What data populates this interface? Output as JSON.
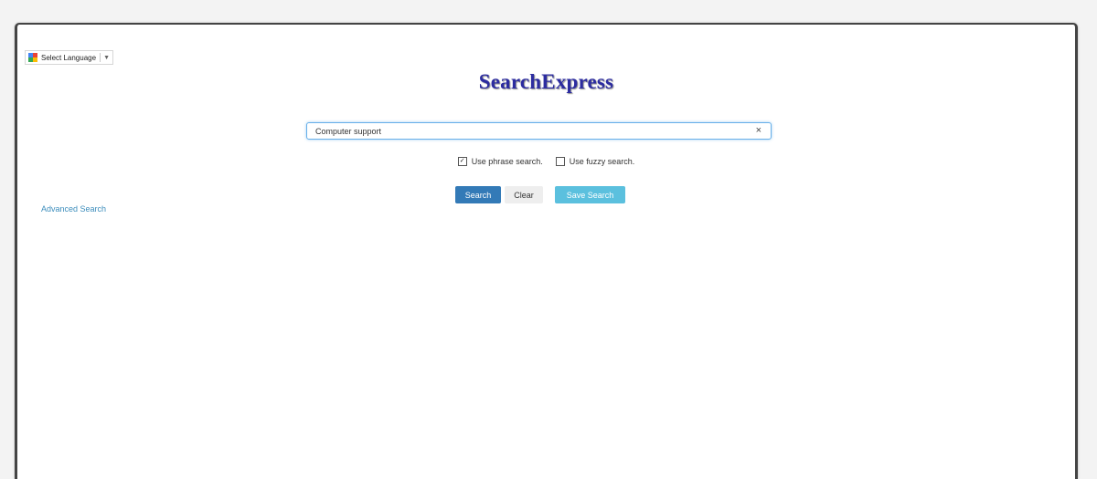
{
  "language_widget": {
    "label": "Select Language",
    "arrow": "▼",
    "icon": "google-translate-icon"
  },
  "logo": {
    "text": "SearchExpress",
    "color": "#2c2ca0"
  },
  "search": {
    "value": "Computer support",
    "clear_symbol": "×"
  },
  "options": {
    "phrase_search": {
      "label": "Use phrase search.",
      "checked": true
    },
    "fuzzy_search": {
      "label": "Use fuzzy search.",
      "checked": false
    }
  },
  "buttons": {
    "search_label": "Search",
    "clear_label": "Clear",
    "save_label": "Save Search"
  },
  "colors": {
    "primary": "#337ab7",
    "info": "#5bc0de",
    "link": "#3c8dbc"
  },
  "advanced_search_link": "Advanced Search"
}
